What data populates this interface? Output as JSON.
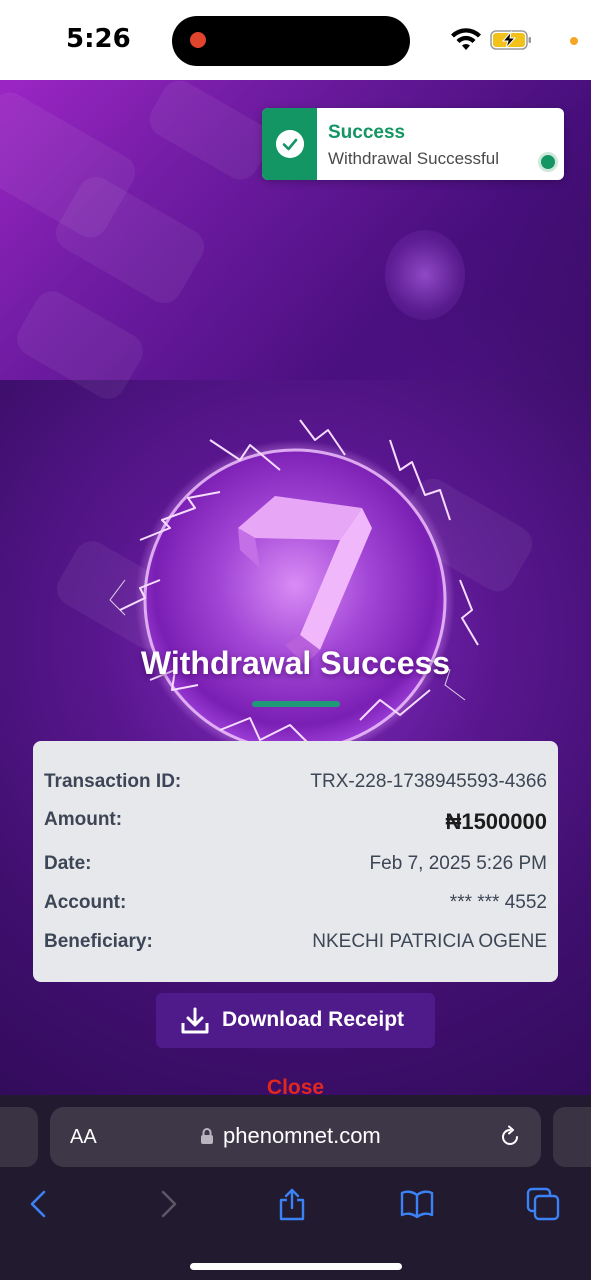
{
  "status_bar": {
    "time": "5:26",
    "icons": [
      "wifi-icon",
      "battery-charging-icon"
    ]
  },
  "toast": {
    "title": "Success",
    "message": "Withdrawal Successful",
    "accent_color": "#139664",
    "icon": "check-icon"
  },
  "hero": {
    "title": "Withdrawal Success",
    "underline_color": "#1f9a78"
  },
  "details": [
    {
      "label": "Transaction ID:",
      "value": "TRX-228-1738945593-4366"
    },
    {
      "label": "Amount:",
      "value": "₦1500000"
    },
    {
      "label": "Date:",
      "value": "Feb 7, 2025 5:26 PM"
    },
    {
      "label": "Account:",
      "value": "*** *** 4552"
    },
    {
      "label": "Beneficiary:",
      "value": "NKECHI PATRICIA OGENE"
    }
  ],
  "actions": {
    "download_label": "Download Receipt",
    "download_icon": "download-icon",
    "close_label": "Close"
  },
  "browser": {
    "text_size_label": "AA",
    "url": "phenomnet.com",
    "toolbar_icons": [
      "back-icon",
      "forward-icon",
      "share-icon",
      "bookmarks-icon",
      "tabs-icon"
    ]
  }
}
